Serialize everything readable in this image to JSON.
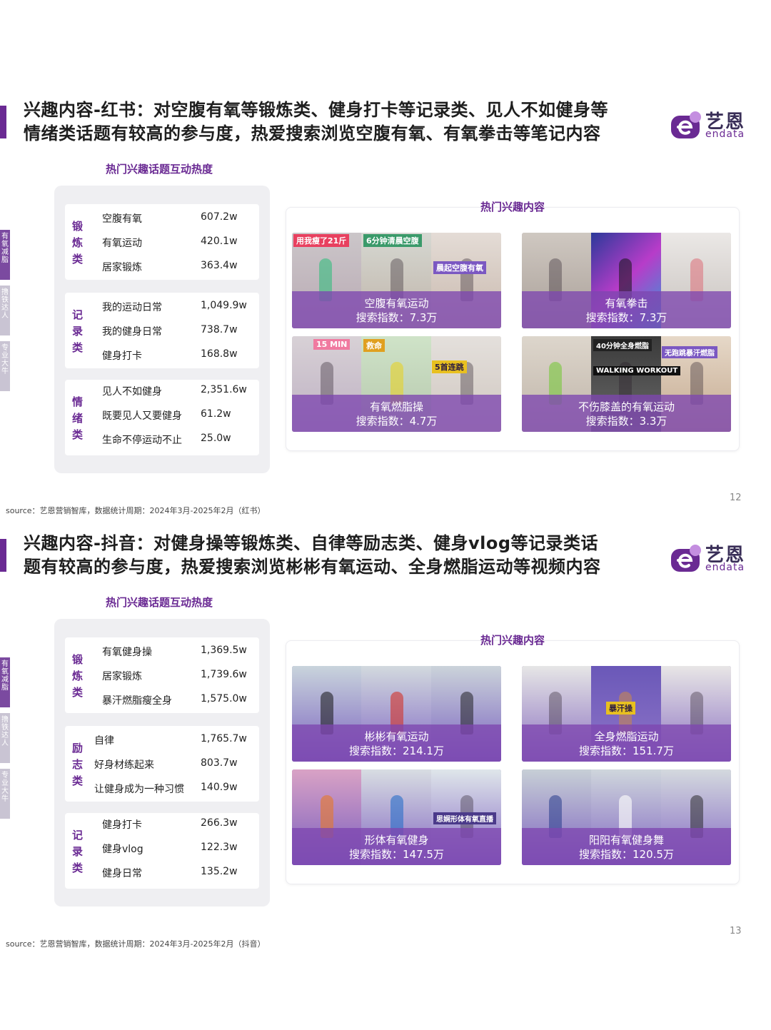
{
  "slides": [
    {
      "headline_line1": "兴趣内容-红书：对空腹有氧等锻炼类、健身打卡等记录类、见人不如健身等",
      "headline_line2": "情绪类话题有较高的参与度，热爱搜索浏览空腹有氧、有氧拳击等笔记内容",
      "logo_cn": "艺恩",
      "logo_en": "endata",
      "topics_title": "热门兴趣话题互动热度",
      "content_title": "热门兴趣内容",
      "side_tabs": [
        "有氧减脂",
        "撸铁达人",
        "专业大牛"
      ],
      "groups": [
        {
          "name": "锻炼类",
          "items": [
            {
              "label": "空腹有氧",
              "value": "607.2w"
            },
            {
              "label": "有氧运动",
              "value": "420.1w"
            },
            {
              "label": "居家锻炼",
              "value": "363.4w"
            }
          ]
        },
        {
          "name": "记录类",
          "items": [
            {
              "label": "我的运动日常",
              "value": "1,049.9w"
            },
            {
              "label": "我的健身日常",
              "value": "738.7w"
            },
            {
              "label": "健身打卡",
              "value": "168.8w"
            }
          ]
        },
        {
          "name": "情绪类",
          "items": [
            {
              "label": "见人不如健身",
              "value": "2,351.6w"
            },
            {
              "label": "既要见人又要健身",
              "value": "61.2w"
            },
            {
              "label": "生命不停运动不止",
              "value": "25.0w"
            }
          ]
        }
      ],
      "cards": [
        {
          "title": "空腹有氧运动",
          "index": "搜索指数：7.3万",
          "banners": [
            "用我瘦了21斤",
            "6分钟清晨空腹",
            "晨起空腹有氧"
          ]
        },
        {
          "title": "有氧拳击",
          "index": "搜索指数：7.3万",
          "banners": []
        },
        {
          "title": "有氧燃脂操",
          "index": "搜索指数：4.7万",
          "banners": [
            "15 MIN",
            "救命",
            "5首连跳"
          ]
        },
        {
          "title": "不伤膝盖的有氧运动",
          "index": "搜索指数：3.3万",
          "banners": [
            "40分钟全身燃脂",
            "WALKING WORKOUT",
            "无跑跳暴汗燃脂"
          ]
        }
      ],
      "source": "source：艺恩营销智库，数据统计周期：2024年3月-2025年2月（红书）",
      "page": "12"
    },
    {
      "headline_line1": "兴趣内容-抖音：对健身操等锻炼类、自律等励志类、健身vlog等记录类话",
      "headline_line2": "题有较高的参与度，热爱搜索浏览彬彬有氧运动、全身燃脂运动等视频内容",
      "logo_cn": "艺恩",
      "logo_en": "endata",
      "topics_title": "热门兴趣话题互动热度",
      "content_title": "热门兴趣内容",
      "side_tabs": [
        "有氧减脂",
        "撸铁达人",
        "专业大牛"
      ],
      "groups": [
        {
          "name": "锻炼类",
          "items": [
            {
              "label": "有氧健身操",
              "value": "1,369.5w"
            },
            {
              "label": "居家锻炼",
              "value": "1,739.6w"
            },
            {
              "label": "暴汗燃脂瘦全身",
              "value": "1,575.0w"
            }
          ]
        },
        {
          "name": "励志类",
          "items": [
            {
              "label": "自律",
              "value": "1,765.7w"
            },
            {
              "label": "好身材练起来",
              "value": "803.7w"
            },
            {
              "label": "让健身成为一种习惯",
              "value": "140.9w"
            }
          ]
        },
        {
          "name": "记录类",
          "items": [
            {
              "label": "健身打卡",
              "value": "266.3w"
            },
            {
              "label": "健身vlog",
              "value": "122.3w"
            },
            {
              "label": "健身日常",
              "value": "135.2w"
            }
          ]
        }
      ],
      "cards": [
        {
          "title": "彬彬有氧运动",
          "index": "搜索指数：214.1万",
          "banners": []
        },
        {
          "title": "全身燃脂运动",
          "index": "搜索指数：151.7万",
          "banners": [
            "暴汗操"
          ]
        },
        {
          "title": "形体有氧健身",
          "index": "搜索指数：147.5万",
          "banners": [
            "思娴形体有氧直播"
          ]
        },
        {
          "title": "阳阳有氧健身舞",
          "index": "搜索指数：120.5万",
          "banners": []
        }
      ],
      "source": "source：艺恩营销智库，数据统计周期：2024年3月-2025年2月（抖音）",
      "page": "13"
    }
  ],
  "colors": {
    "accent": "#6a2a93",
    "overlay": "#7d46af",
    "panel": "#efeff2"
  }
}
